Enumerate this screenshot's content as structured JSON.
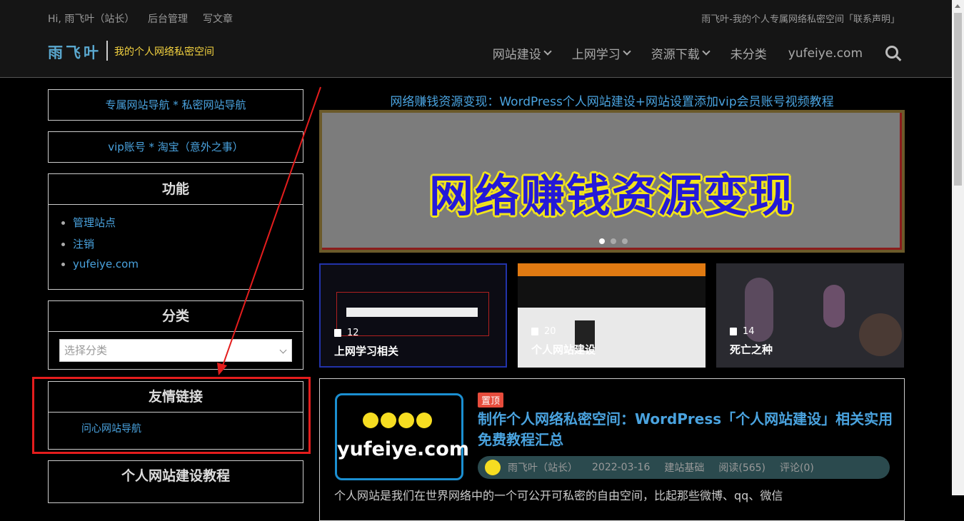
{
  "topbar": {
    "greeting": "Hi, 雨飞叶（站长）",
    "admin": "后台管理",
    "write": "写文章",
    "site_statement": "雨飞叶-我的个人专属网络私密空间「联系声明」"
  },
  "brand": {
    "logo": "雨飞叶",
    "tagline": "我的个人网络私密空间"
  },
  "nav": {
    "items": [
      "网站建设",
      "上网学习",
      "资源下载",
      "未分类",
      "yufeiye.com"
    ],
    "search_icon": "search-icon"
  },
  "sidebar": {
    "link_box_1": "专属网站导航 * 私密网站导航",
    "link_box_2": "vip账号 * 淘宝（意外之事）",
    "functions": {
      "title": "功能",
      "items": [
        "管理站点",
        "注销",
        "yufeiye.com"
      ]
    },
    "categories": {
      "title": "分类",
      "placeholder": "选择分类"
    },
    "friends": {
      "title": "友情链接",
      "link": "问心网站导航"
    },
    "tutorial_title": "个人网站建设教程"
  },
  "main": {
    "featured_title": "网络赚钱资源变现：WordPress个人网站建设+网站设置添加vip会员账号视频教程",
    "slider_text": "网络赚钱资源变现",
    "cards": [
      {
        "count": "12",
        "name": "上网学习相关"
      },
      {
        "count": "20",
        "name": "个人网站建设"
      },
      {
        "count": "14",
        "name": "死亡之种"
      }
    ],
    "post": {
      "sticky": "置顶",
      "thumb_text": "yufeiye.com",
      "title": "制作个人网络私密空间：WordPress「个人网站建设」相关实用免费教程汇总",
      "author": "雨飞叶（站长）",
      "date": "2022-03-16",
      "category": "建站基础",
      "views": "阅读(565)",
      "comments": "评论(0)",
      "excerpt": "个人网站是我们在世界网络中的一个可公开可私密的自由空间，比起那些微博、qq、微信"
    }
  },
  "colors": {
    "accent": "#4aa3df",
    "tagline": "#f3d240",
    "annotation_red": "#e41d1d"
  }
}
